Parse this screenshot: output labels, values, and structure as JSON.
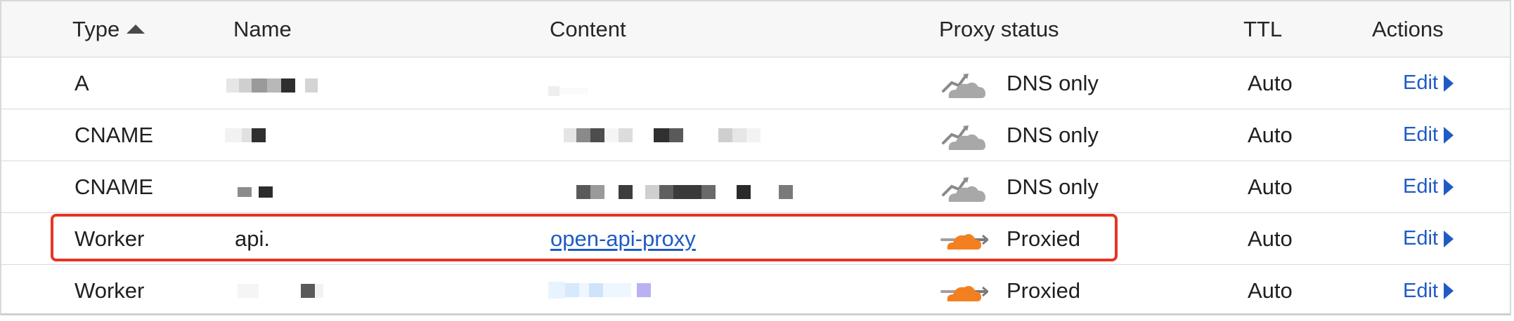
{
  "header": {
    "type": "Type",
    "name": "Name",
    "content": "Content",
    "proxy_status": "Proxy status",
    "ttl": "TTL",
    "actions": "Actions"
  },
  "rows": [
    {
      "type": "A",
      "name": "",
      "content": "",
      "proxy": "DNS only",
      "proxy_icon": "dns-only-cloud-icon",
      "ttl": "Auto",
      "action": "Edit"
    },
    {
      "type": "CNAME",
      "name": "",
      "content": "",
      "proxy": "DNS only",
      "proxy_icon": "dns-only-cloud-icon",
      "ttl": "Auto",
      "action": "Edit"
    },
    {
      "type": "CNAME",
      "name": "",
      "content": "",
      "proxy": "DNS only",
      "proxy_icon": "dns-only-cloud-icon",
      "ttl": "Auto",
      "action": "Edit"
    },
    {
      "type": "Worker",
      "name": "api.",
      "content": "open-api-proxy",
      "proxy": "Proxied",
      "proxy_icon": "proxied-cloud-icon",
      "ttl": "Auto",
      "action": "Edit"
    },
    {
      "type": "Worker",
      "name": "",
      "content": "",
      "proxy": "Proxied",
      "proxy_icon": "proxied-cloud-icon",
      "ttl": "Auto",
      "action": "Edit"
    }
  ],
  "colors": {
    "link": "#1f5bc4",
    "proxied_cloud": "#f38020",
    "dns_only_cloud": "#8a8a8a",
    "highlight_border": "#e53426"
  }
}
